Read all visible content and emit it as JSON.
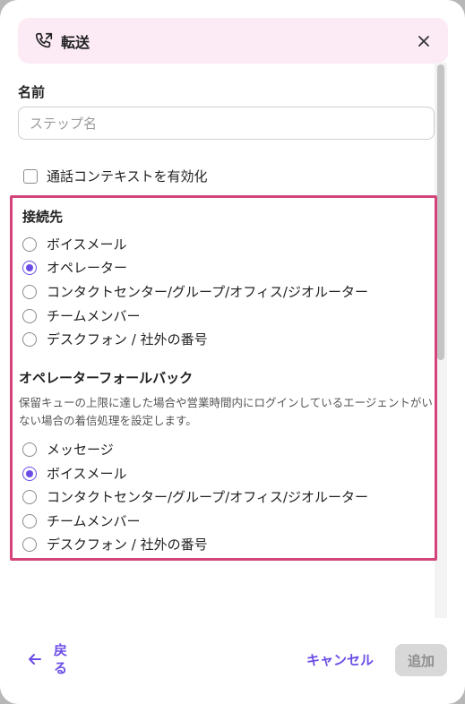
{
  "header": {
    "title": "転送",
    "icon": "phone-forward-icon",
    "close_icon": "close-icon"
  },
  "name_field": {
    "label": "名前",
    "placeholder": "ステップ名",
    "value": ""
  },
  "call_context": {
    "label": "通話コンテキストを有効化",
    "checked": false
  },
  "destination": {
    "title": "接続先",
    "options": [
      {
        "label": "ボイスメール",
        "selected": false
      },
      {
        "label": "オペレーター",
        "selected": true
      },
      {
        "label": "コンタクトセンター/グループ/オフィス/ジオルーター",
        "selected": false
      },
      {
        "label": "チームメンバー",
        "selected": false
      },
      {
        "label": "デスクフォン / 社外の番号",
        "selected": false
      }
    ]
  },
  "fallback": {
    "title": "オペレーターフォールバック",
    "description": "保留キューの上限に達した場合や営業時間内にログインしているエージェントがいない場合の着信処理を設定します。",
    "options": [
      {
        "label": "メッセージ",
        "selected": false
      },
      {
        "label": "ボイスメール",
        "selected": true
      },
      {
        "label": "コンタクトセンター/グループ/オフィス/ジオルーター",
        "selected": false
      },
      {
        "label": "チームメンバー",
        "selected": false
      },
      {
        "label": "デスクフォン / 社外の番号",
        "selected": false
      }
    ]
  },
  "footer": {
    "back_label": "戻る",
    "cancel_label": "キャンセル",
    "add_label": "追加"
  },
  "colors": {
    "accent": "#6b4de6",
    "highlight": "#d4447a",
    "header_bg": "#fcebf5"
  }
}
